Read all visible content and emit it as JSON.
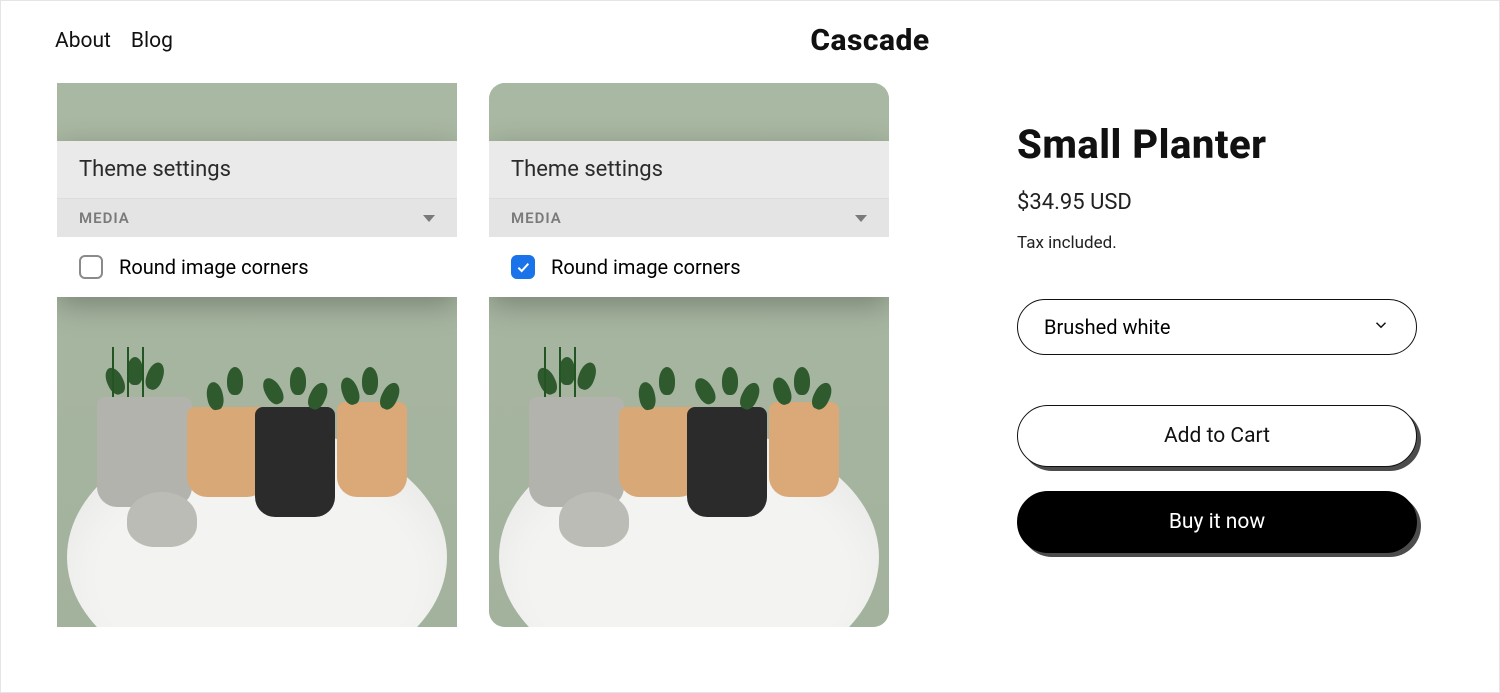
{
  "nav": {
    "about": "About",
    "blog": "Blog"
  },
  "brand": "Cascade",
  "settings": {
    "title": "Theme settings",
    "section": "MEDIA",
    "option_label": "Round image corners"
  },
  "panels": [
    {
      "checked": false,
      "rounded": false
    },
    {
      "checked": true,
      "rounded": true
    }
  ],
  "product": {
    "title": "Small Planter",
    "price": "$34.95 USD",
    "tax_note": "Tax included.",
    "variant_selected": "Brushed white",
    "add_to_cart": "Add to Cart",
    "buy_now": "Buy it now"
  }
}
